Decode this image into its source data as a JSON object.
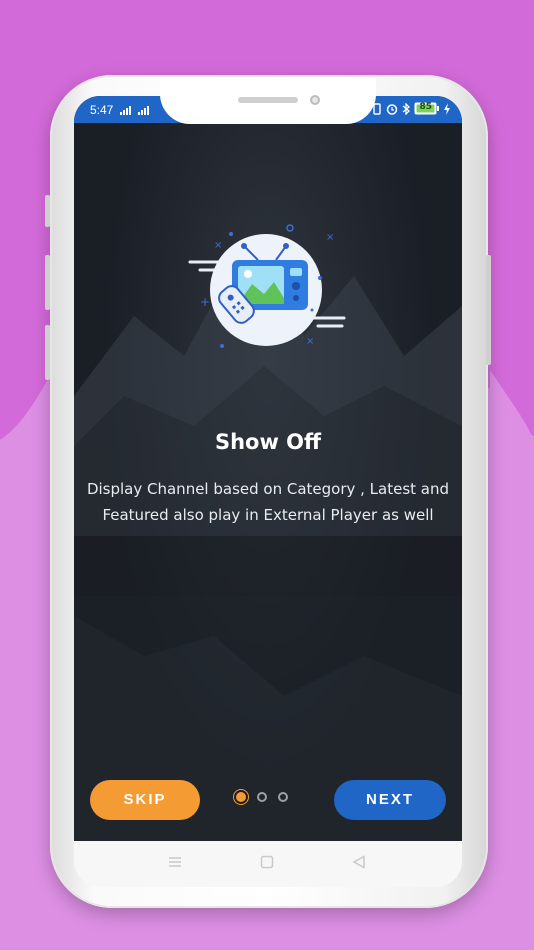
{
  "status_bar": {
    "time": "5:47",
    "battery": "85"
  },
  "slide": {
    "title": "Show Off",
    "description": "Display Channel based on Category , Latest and Featured also play in External Player as well"
  },
  "buttons": {
    "skip_label": "SKIP",
    "next_label": "NEXT"
  },
  "pager": {
    "total": 3,
    "active_index": 0
  },
  "colors": {
    "background": "#d36ad9",
    "status_bar": "#1f66c7",
    "skip": "#f59b34",
    "next": "#1f66c7"
  },
  "icons": [
    "signal-icon",
    "alarm-icon",
    "bluetooth-icon",
    "battery-icon",
    "tv-remote-illustration",
    "menu-nav-icon",
    "home-nav-icon",
    "back-nav-icon"
  ]
}
